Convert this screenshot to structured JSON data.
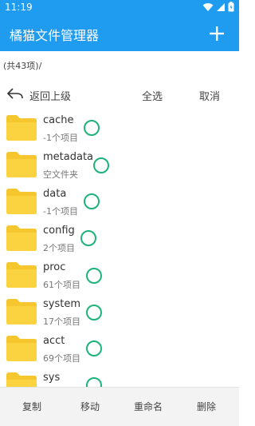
{
  "status": {
    "time": "11:19"
  },
  "app": {
    "title": "橘猫文件管理器"
  },
  "path": {
    "label": "(共43项)/"
  },
  "toolbar": {
    "back_label": "返回上级",
    "select_all_label": "全选",
    "cancel_label": "取消"
  },
  "files": [
    {
      "name": "cache",
      "info": "-1个项目"
    },
    {
      "name": "metadata",
      "info": "空文件夹"
    },
    {
      "name": "data",
      "info": "-1个项目"
    },
    {
      "name": "config",
      "info": "2个项目"
    },
    {
      "name": "proc",
      "info": "61个项目"
    },
    {
      "name": "system",
      "info": "17个项目"
    },
    {
      "name": "acct",
      "info": "69个项目"
    },
    {
      "name": "sys",
      "info": ""
    }
  ],
  "bottom": {
    "copy_label": "复制",
    "move_label": "移动",
    "rename_label": "重命名",
    "delete_label": "删除"
  },
  "colors": {
    "primary": "#1f9bf0",
    "folder": "#f6c62e",
    "check": "#1db37a"
  }
}
